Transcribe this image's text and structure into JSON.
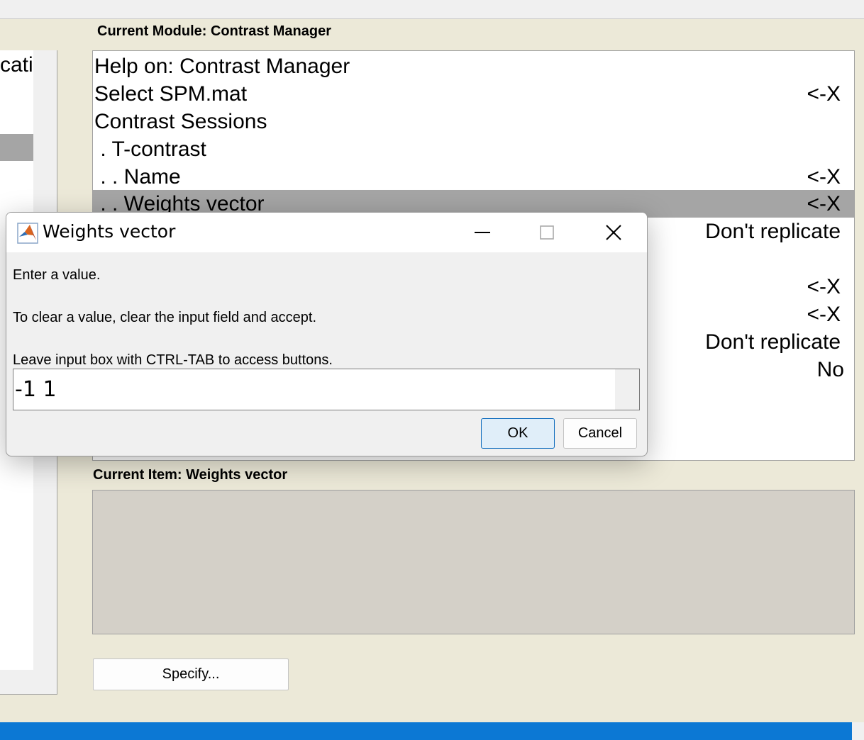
{
  "window": {
    "left_panel_text": "cati"
  },
  "module": {
    "title": "Current Module: Contrast Manager",
    "rows": [
      {
        "label": "Help on: Contrast Manager",
        "value": ""
      },
      {
        "label": "Select SPM.mat",
        "value": "<-X"
      },
      {
        "label": "Contrast Sessions",
        "value": ""
      },
      {
        "label": " . T-contrast",
        "value": ""
      },
      {
        "label": " . . Name",
        "value": "<-X"
      },
      {
        "label": " . . Weights vector",
        "value": "<-X",
        "selected": true
      },
      {
        "label": "",
        "value": "Don't replicate"
      },
      {
        "label": "",
        "value": ""
      },
      {
        "label": "",
        "value": "<-X"
      },
      {
        "label": "",
        "value": "<-X"
      },
      {
        "label": "",
        "value": "Don't replicate"
      },
      {
        "label": "",
        "value": "No"
      }
    ]
  },
  "current_item": {
    "title": "Current Item: Weights vector",
    "specify_label": "Specify..."
  },
  "dialog": {
    "title": "Weights vector",
    "message_lines": [
      "Enter a value.",
      "To clear a value, clear the input field and accept.",
      "Leave input box with CTRL-TAB to access buttons."
    ],
    "input_value": "-1 1",
    "ok_label": "OK",
    "cancel_label": "Cancel",
    "icon": "matlab-icon"
  },
  "colors": {
    "taskbar": "#0c78d4",
    "selection": "#a5a5a5",
    "panel_bg": "#ece9d8"
  }
}
